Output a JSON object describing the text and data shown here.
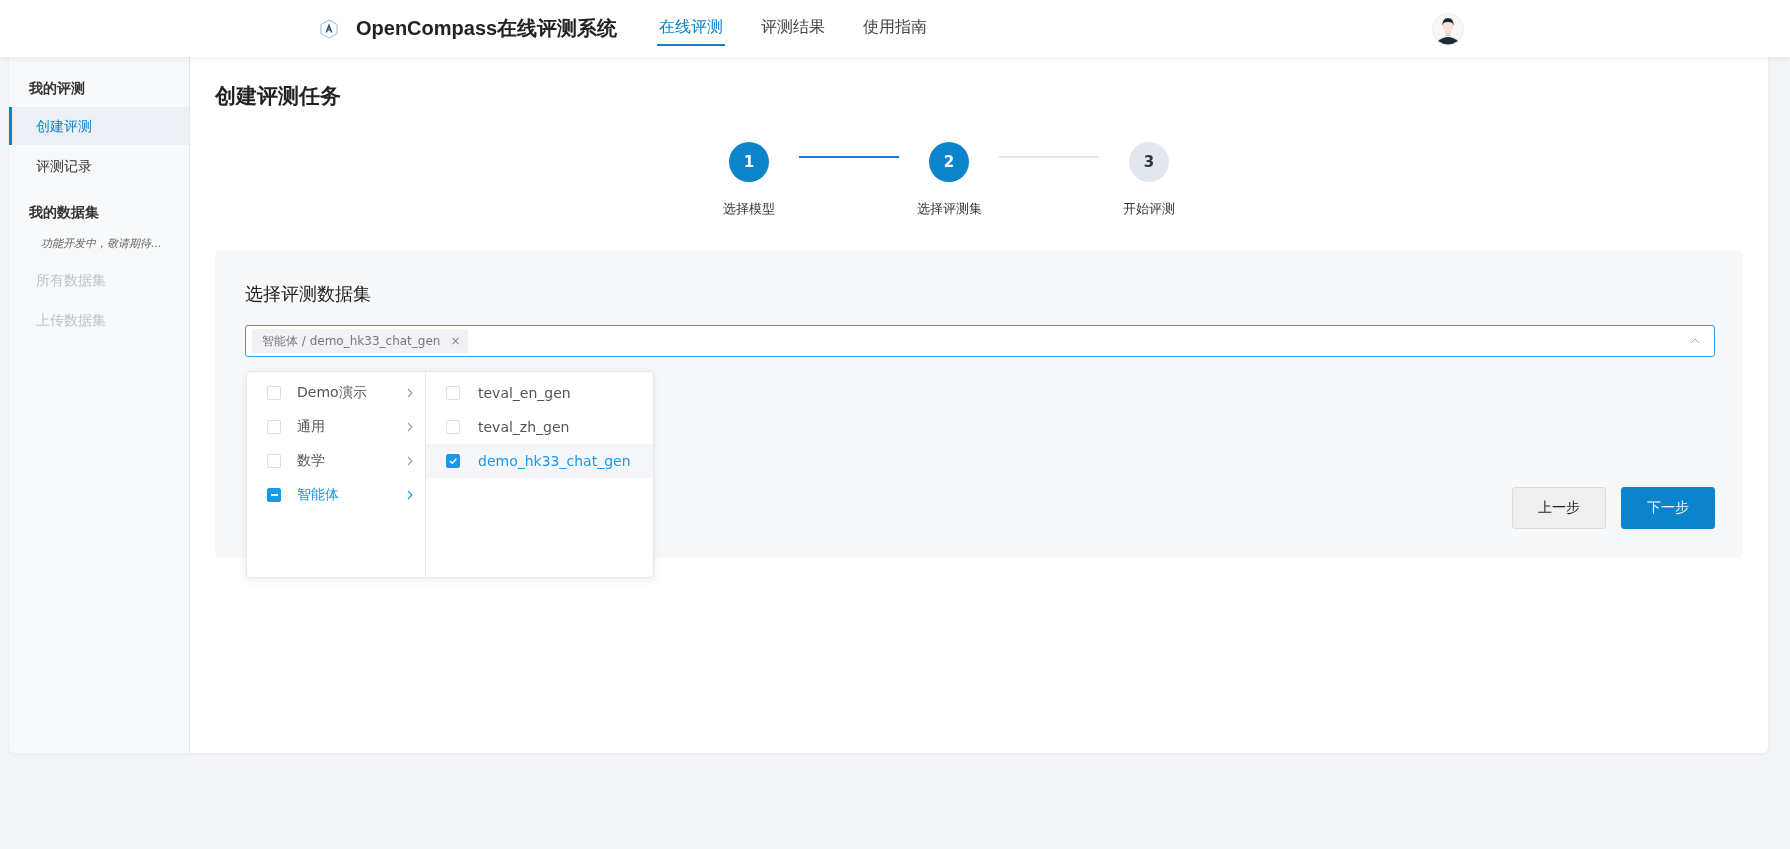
{
  "header": {
    "title": "OpenCompass在线评测系统",
    "nav": [
      {
        "label": "在线评测",
        "selected": true
      },
      {
        "label": "评测结果",
        "selected": false
      },
      {
        "label": "使用指南",
        "selected": false
      }
    ]
  },
  "sidebar": {
    "items": [
      {
        "kind": "heading",
        "label": "我的评测"
      },
      {
        "kind": "link",
        "label": "创建评测",
        "selected": true,
        "disabled": false
      },
      {
        "kind": "link",
        "label": "评测记录",
        "selected": false,
        "disabled": false
      },
      {
        "kind": "heading",
        "label": "我的数据集"
      },
      {
        "kind": "note",
        "label": "功能开发中，敬请期待..."
      },
      {
        "kind": "link",
        "label": "所有数据集",
        "selected": false,
        "disabled": true
      },
      {
        "kind": "link",
        "label": "上传数据集",
        "selected": false,
        "disabled": true
      }
    ]
  },
  "page_title": "创建评测任务",
  "steps": [
    {
      "number": "1",
      "label": "选择模型",
      "done": true
    },
    {
      "number": "2",
      "label": "选择评测集",
      "done": true
    },
    {
      "number": "3",
      "label": "开始评测",
      "done": false
    }
  ],
  "panel": {
    "title": "选择评测数据集",
    "select": {
      "tags": [
        {
          "label": "智能体 / demo_hk33_chat_gen",
          "close": "×"
        }
      ],
      "expanded": true
    },
    "categories": [
      {
        "label": "Demo演示",
        "checked": false,
        "indeterminate": false,
        "selected": false
      },
      {
        "label": "通用",
        "checked": false,
        "indeterminate": false,
        "selected": false
      },
      {
        "label": "数学",
        "checked": false,
        "indeterminate": false,
        "selected": false
      },
      {
        "label": "智能体",
        "checked": false,
        "indeterminate": true,
        "selected": true
      }
    ],
    "datasets": [
      {
        "label": "teval_en_gen",
        "checked": false
      },
      {
        "label": "teval_zh_gen",
        "checked": false
      },
      {
        "label": "demo_hk33_chat_gen",
        "checked": true
      }
    ],
    "buttons": [
      {
        "label": "上一步",
        "kind": "secondary"
      },
      {
        "label": "下一步",
        "kind": "primary"
      }
    ]
  }
}
